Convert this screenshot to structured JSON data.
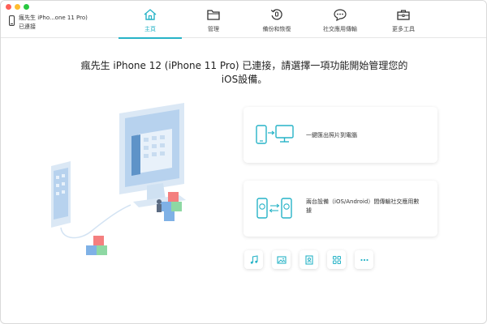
{
  "window": {
    "device_name": "瘋先生 iPho...one  11 Pro)",
    "device_status": "已連接"
  },
  "nav": {
    "tabs": [
      {
        "label": "主頁",
        "icon": "home-icon",
        "active": true
      },
      {
        "label": "管理",
        "icon": "folder-icon",
        "active": false
      },
      {
        "label": "備份和恢復",
        "icon": "backup-restore-icon",
        "active": false
      },
      {
        "label": "社交應用傳輸",
        "icon": "chat-transfer-icon",
        "active": false
      },
      {
        "label": "更多工具",
        "icon": "toolbox-icon",
        "active": false
      }
    ]
  },
  "main": {
    "headline_line1": "瘋先生 iPhone 12 (iPhone  11 Pro)  已連接，請選擇一項功能開始管理您的",
    "headline_line2": "iOS設備。",
    "cards": [
      {
        "label": "一鍵匯出照片到電腦",
        "icon": "phone-to-computer-icon"
      },
      {
        "label": "兩台設備（iOS/Android）間傳輸社交應用數據",
        "icon": "phone-to-phone-chat-icon"
      }
    ],
    "tools": [
      {
        "name": "music-icon"
      },
      {
        "name": "photo-icon"
      },
      {
        "name": "contact-icon"
      },
      {
        "name": "apps-icon"
      },
      {
        "name": "more-icon"
      }
    ]
  },
  "colors": {
    "accent": "#27b3c7",
    "illustration_light": "#cfe1f2",
    "illustration_mid": "#9ec4ea"
  }
}
